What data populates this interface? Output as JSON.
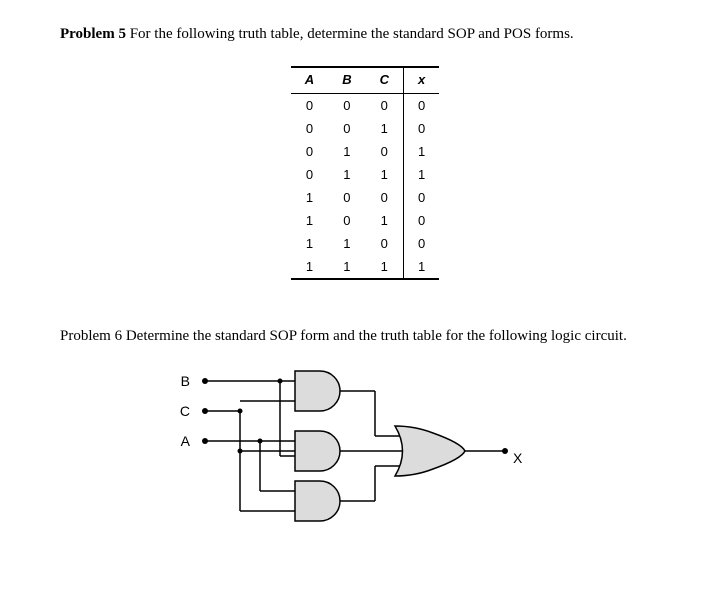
{
  "problem5": {
    "label": "Problem 5",
    "text": " For the following truth table, determine the standard SOP and POS forms.",
    "headers": [
      "A",
      "B",
      "C",
      "x"
    ],
    "rows": [
      [
        "0",
        "0",
        "0",
        "0"
      ],
      [
        "0",
        "0",
        "1",
        "0"
      ],
      [
        "0",
        "1",
        "0",
        "1"
      ],
      [
        "0",
        "1",
        "1",
        "1"
      ],
      [
        "1",
        "0",
        "0",
        "0"
      ],
      [
        "1",
        "0",
        "1",
        "0"
      ],
      [
        "1",
        "1",
        "0",
        "0"
      ],
      [
        "1",
        "1",
        "1",
        "1"
      ]
    ]
  },
  "problem6": {
    "label": "Problem 6",
    "text": " Determine the standard SOP form and the truth table for the following logic circuit.",
    "inputs": {
      "B": "B",
      "C": "C",
      "A": "A"
    },
    "output": "X"
  }
}
